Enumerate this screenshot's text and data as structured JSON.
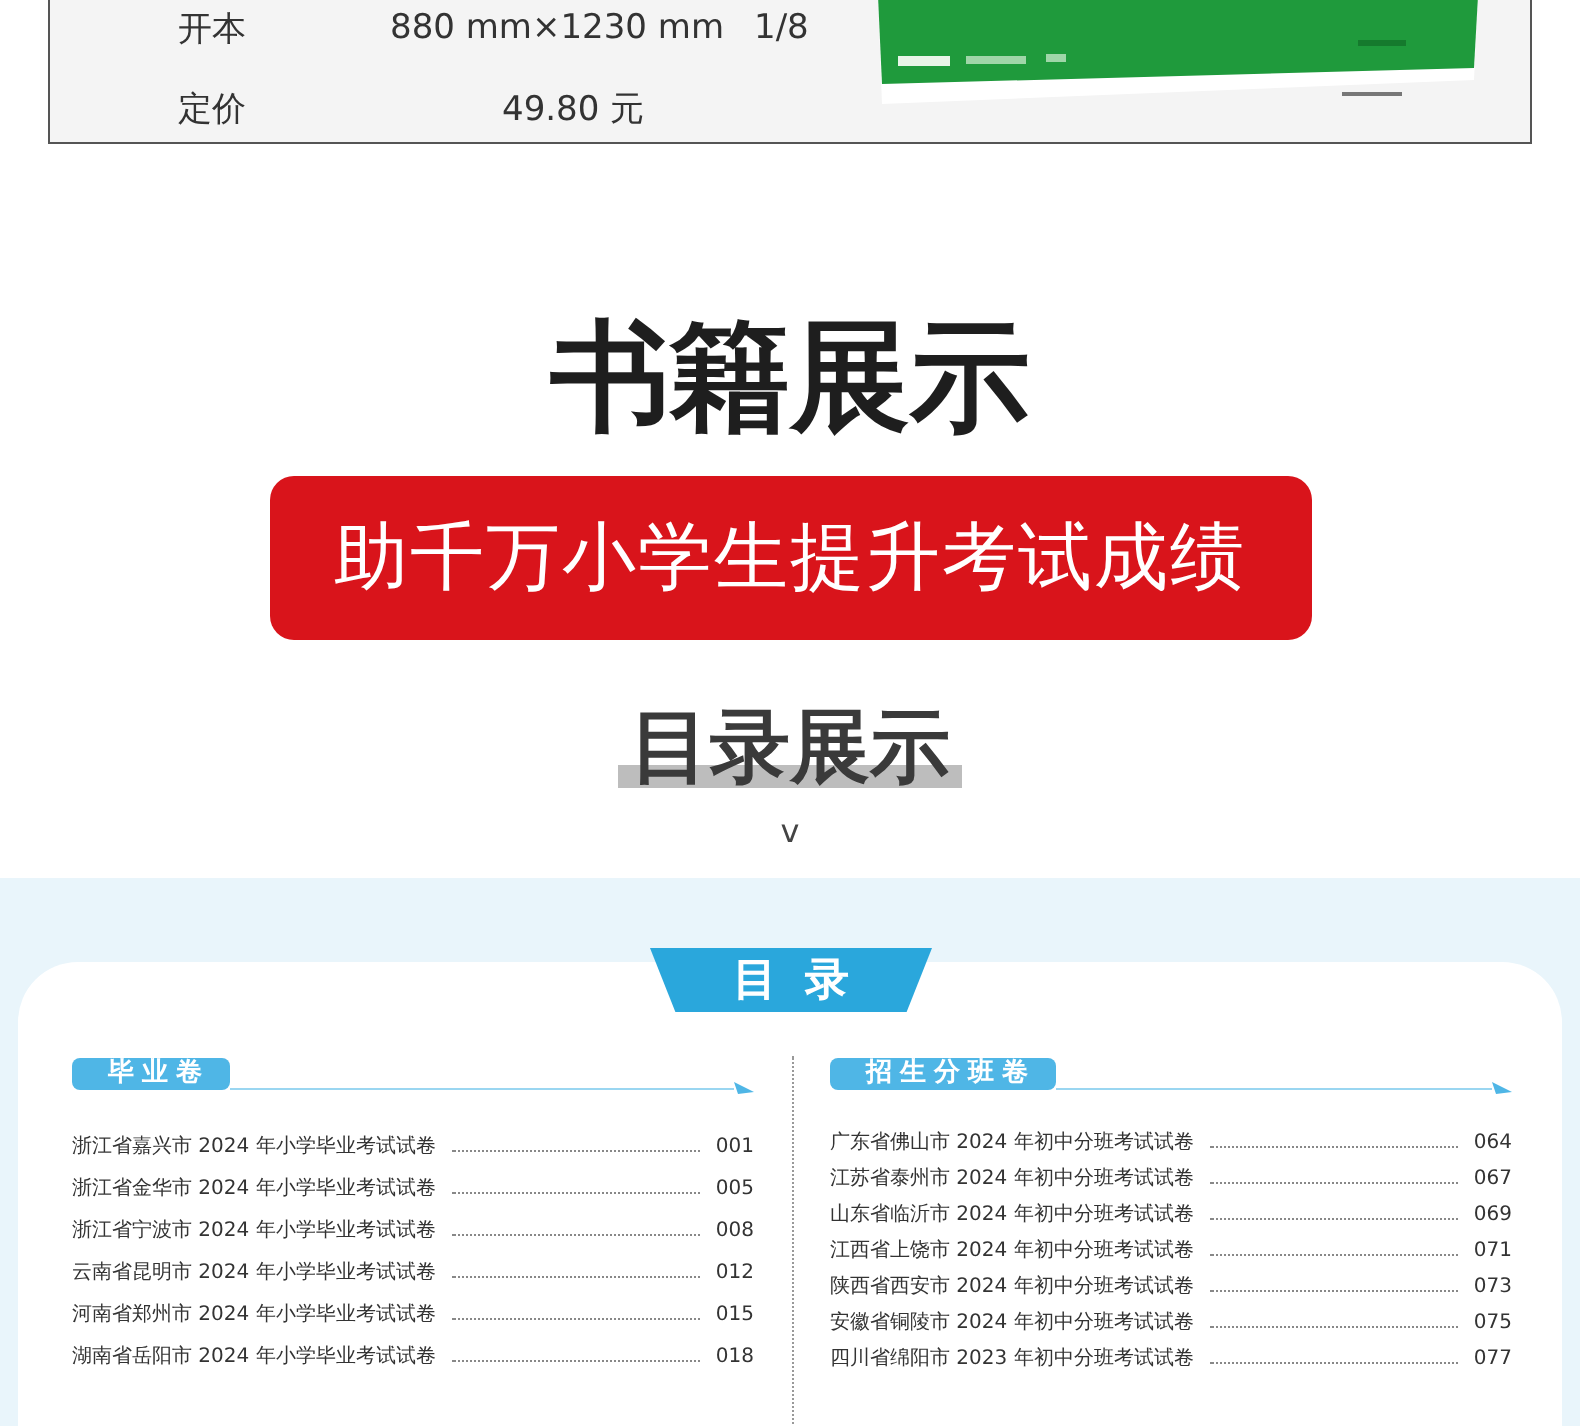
{
  "specs": [
    {
      "label": "开本",
      "value": "880 mm×1230 mm",
      "extra": "1/8"
    },
    {
      "label": "定价",
      "value": "49.80 元"
    }
  ],
  "heading": "书籍展示",
  "banner": "助千万小学生提升考试成绩",
  "toc_heading": "目录展示",
  "chevron": "v",
  "toc": {
    "tab": "目录",
    "sections": [
      {
        "title": "毕业卷",
        "entries": [
          {
            "title": "浙江省嘉兴市 2024 年小学毕业考试试卷",
            "page": "001"
          },
          {
            "title": "浙江省金华市 2024 年小学毕业考试试卷",
            "page": "005"
          },
          {
            "title": "浙江省宁波市 2024 年小学毕业考试试卷",
            "page": "008"
          },
          {
            "title": "云南省昆明市 2024 年小学毕业考试试卷",
            "page": "012"
          },
          {
            "title": "河南省郑州市 2024 年小学毕业考试试卷",
            "page": "015"
          },
          {
            "title": "湖南省岳阳市 2024 年小学毕业考试试卷",
            "page": "018"
          }
        ]
      },
      {
        "title": "招生分班卷",
        "entries": [
          {
            "title": "广东省佛山市 2024 年初中分班考试试卷",
            "page": "064"
          },
          {
            "title": "江苏省泰州市 2024 年初中分班考试试卷",
            "page": "067"
          },
          {
            "title": "山东省临沂市 2024 年初中分班考试试卷",
            "page": "069"
          },
          {
            "title": "江西省上饶市 2024 年初中分班考试试卷",
            "page": "071"
          },
          {
            "title": "陕西省西安市 2024 年初中分班考试试卷",
            "page": "073"
          },
          {
            "title": "安徽省铜陵市 2024 年初中分班考试试卷",
            "page": "075"
          },
          {
            "title": "四川省绵阳市 2023 年初中分班考试试卷",
            "page": "077"
          }
        ]
      }
    ]
  }
}
